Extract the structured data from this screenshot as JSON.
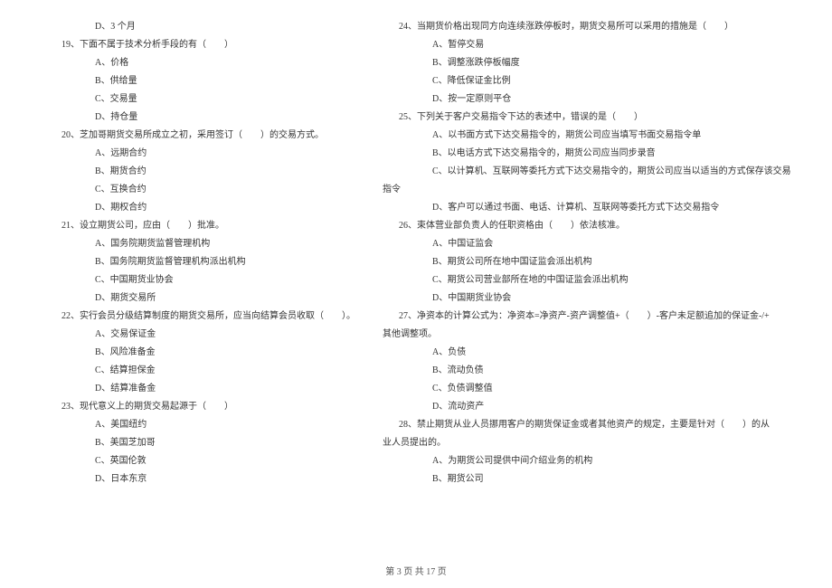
{
  "footer": "第 3 页 共 17 页",
  "left_column": [
    {
      "cls": "option",
      "text": "D、3 个月"
    },
    {
      "cls": "question",
      "text": "19、下面不属于技术分析手段的有（　　）"
    },
    {
      "cls": "option",
      "text": "A、价格"
    },
    {
      "cls": "option",
      "text": "B、供给量"
    },
    {
      "cls": "option",
      "text": "C、交易量"
    },
    {
      "cls": "option",
      "text": "D、持仓量"
    },
    {
      "cls": "question",
      "text": "20、芝加哥期货交易所成立之初，采用签订（　　）的交易方式。"
    },
    {
      "cls": "option",
      "text": "A、远期合约"
    },
    {
      "cls": "option",
      "text": "B、期货合约"
    },
    {
      "cls": "option",
      "text": "C、互换合约"
    },
    {
      "cls": "option",
      "text": "D、期权合约"
    },
    {
      "cls": "question",
      "text": "21、设立期货公司，应由（　　）批准。"
    },
    {
      "cls": "option",
      "text": "A、国务院期货监督管理机构"
    },
    {
      "cls": "option",
      "text": "B、国务院期货监督管理机构派出机构"
    },
    {
      "cls": "option",
      "text": "C、中国期货业协会"
    },
    {
      "cls": "option",
      "text": "D、期货交易所"
    },
    {
      "cls": "question",
      "text": "22、实行会员分级结算制度的期货交易所，应当向结算会员收取（　　）。"
    },
    {
      "cls": "option",
      "text": "A、交易保证金"
    },
    {
      "cls": "option",
      "text": "B、风险准备金"
    },
    {
      "cls": "option",
      "text": "C、结算担保金"
    },
    {
      "cls": "option",
      "text": "D、结算准备金"
    },
    {
      "cls": "question",
      "text": "23、现代意义上的期货交易起源于（　　）"
    },
    {
      "cls": "option",
      "text": "A、美国纽约"
    },
    {
      "cls": "option",
      "text": "B、美国芝加哥"
    },
    {
      "cls": "option",
      "text": "C、英国伦敦"
    },
    {
      "cls": "option",
      "text": "D、日本东京"
    }
  ],
  "right_column": [
    {
      "cls": "question",
      "text": "24、当期货价格出现同方向连续涨跌停板时，期货交易所可以采用的措施是（　　）"
    },
    {
      "cls": "option",
      "text": "A、暂停交易"
    },
    {
      "cls": "option",
      "text": "B、调整涨跌停板幅度"
    },
    {
      "cls": "option",
      "text": "C、降低保证金比例"
    },
    {
      "cls": "option",
      "text": "D、按一定原则平仓"
    },
    {
      "cls": "question",
      "text": "25、下列关于客户交易指令下达的表述中，错误的是（　　）"
    },
    {
      "cls": "option",
      "text": "A、以书面方式下达交易指令的，期货公司应当填写书面交易指令单"
    },
    {
      "cls": "option",
      "text": "B、以电话方式下达交易指令的，期货公司应当同步录音"
    },
    {
      "cls": "option",
      "text": "C、以计算机、互联网等委托方式下达交易指令的，期货公司应当以适当的方式保存该交易"
    },
    {
      "cls": "continuation",
      "text": "指令"
    },
    {
      "cls": "option",
      "text": "D、客户可以通过书面、电话、计算机、互联网等委托方式下达交易指令"
    },
    {
      "cls": "question",
      "text": "26、束体营业部负责人的任职资格由（　　）依法核准。"
    },
    {
      "cls": "option",
      "text": "A、中国证监会"
    },
    {
      "cls": "option",
      "text": "B、期货公司所在地中国证监会派出机构"
    },
    {
      "cls": "option",
      "text": "C、期货公司营业部所在地的中国证监会派出机构"
    },
    {
      "cls": "option",
      "text": "D、中国期货业协会"
    },
    {
      "cls": "question",
      "text": "27、净资本的计算公式为：净资本=净资产-资产调整值+（　　）-客户未足额追加的保证金-/+"
    },
    {
      "cls": "continuation",
      "text": "其他调整项。"
    },
    {
      "cls": "option",
      "text": "A、负债"
    },
    {
      "cls": "option",
      "text": "B、流动负债"
    },
    {
      "cls": "option",
      "text": "C、负债调整值"
    },
    {
      "cls": "option",
      "text": "D、流动资产"
    },
    {
      "cls": "question",
      "text": "28、禁止期货从业人员挪用客户的期货保证金或者其他资产的规定，主要是针对（　　）的从"
    },
    {
      "cls": "continuation",
      "text": "业人员提出的。"
    },
    {
      "cls": "option",
      "text": "A、为期货公司提供中间介绍业务的机构"
    },
    {
      "cls": "option",
      "text": "B、期货公司"
    }
  ]
}
